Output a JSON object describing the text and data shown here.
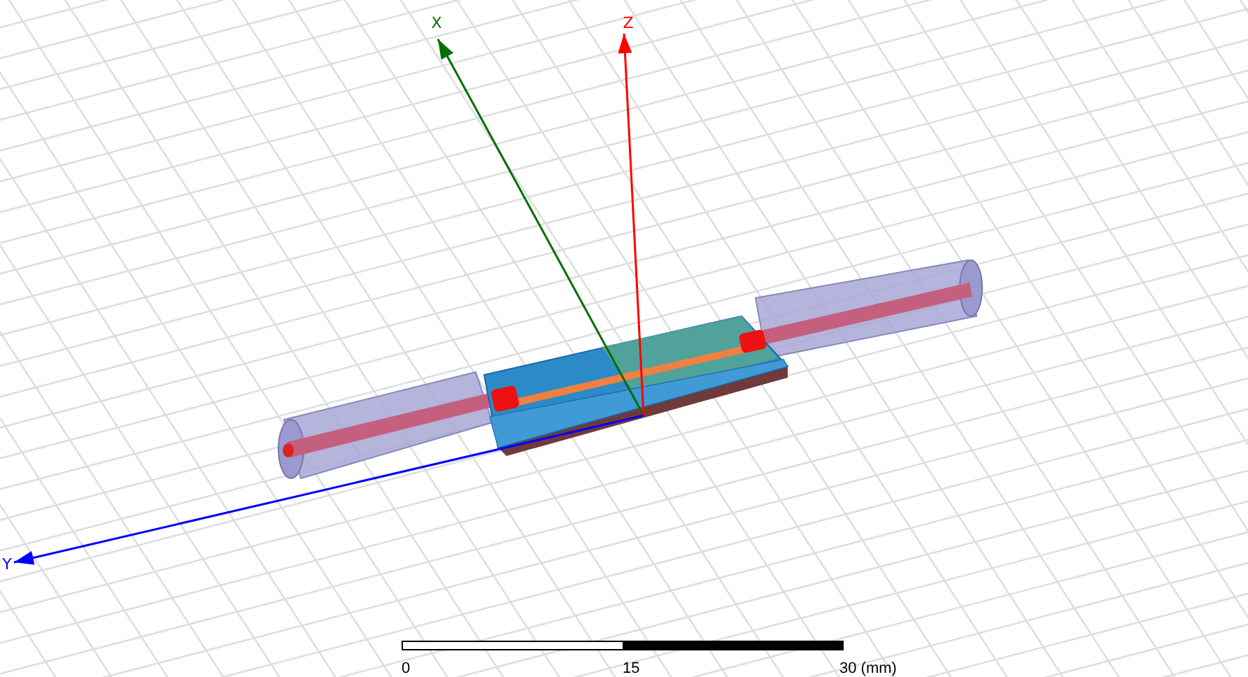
{
  "axes": [
    {
      "label": "X",
      "color": "#007000"
    },
    {
      "label": "Z",
      "color": "#ff0000"
    },
    {
      "label": "Y",
      "color": "#0000ff"
    }
  ],
  "scale_bar": {
    "ticks": [
      "0",
      "15",
      "30 (mm)"
    ]
  }
}
